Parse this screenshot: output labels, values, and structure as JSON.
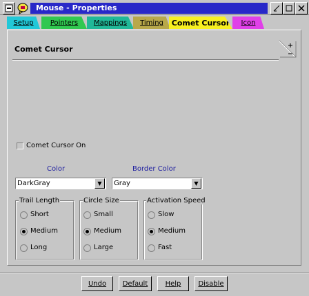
{
  "window": {
    "title": "Mouse - Properties",
    "system_icon": "window-menu-icon",
    "app_icon": "mouse-help-icon",
    "minimize_icon": "minimize-icon",
    "maximize_icon": "maximize-icon",
    "close_icon": "close-icon"
  },
  "tabs": [
    {
      "label": "Setup",
      "color": "#22c8d8"
    },
    {
      "label": "Pointers",
      "color": "#30c850"
    },
    {
      "label": "Mappings",
      "color": "#20b898"
    },
    {
      "label": "Timing",
      "color": "#b8a84a"
    },
    {
      "label": "Comet Cursor",
      "color": "#f8f020",
      "active": true
    },
    {
      "label": "Icon",
      "color": "#e040e8"
    }
  ],
  "page": {
    "title": "Comet Cursor",
    "comet_checkbox": {
      "label": "Comet Cursor On",
      "checked": false
    },
    "color_label": "Color",
    "color_value": "DarkGray",
    "border_color_label": "Border Color",
    "border_color_value": "Gray",
    "trail_length": {
      "title": "Trail Length",
      "options": [
        "Short",
        "Medium",
        "Long"
      ],
      "selected": "Medium"
    },
    "circle_size": {
      "title": "Circle Size",
      "options": [
        "Small",
        "Medium",
        "Large"
      ],
      "selected": "Medium"
    },
    "activation_speed": {
      "title": "Activation Speed",
      "options": [
        "Slow",
        "Medium",
        "Fast"
      ],
      "selected": "Medium"
    },
    "accent_label_color": "#2020a0"
  },
  "buttons": {
    "undo": "Undo",
    "default": "Default",
    "help": "Help",
    "disable": "Disable"
  }
}
